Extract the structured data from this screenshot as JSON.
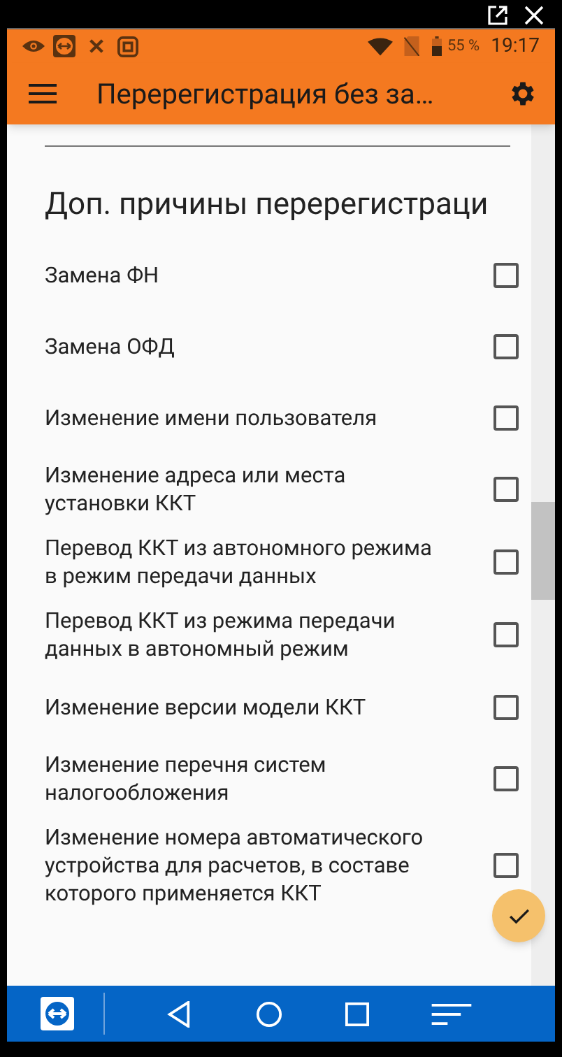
{
  "status_bar": {
    "battery": "55 %",
    "time": "19:17"
  },
  "app_bar": {
    "title": "Перерегистрация без за…"
  },
  "section": {
    "title": "Доп. причины перерегистраци"
  },
  "reasons": [
    {
      "label": "Замена ФН",
      "checked": false
    },
    {
      "label": "Замена ОФД",
      "checked": false
    },
    {
      "label": "Изменение имени пользователя",
      "checked": false
    },
    {
      "label": "Изменение адреса или места установки ККТ",
      "checked": false
    },
    {
      "label": "Перевод ККТ из автономного режима в режим передачи данных",
      "checked": false
    },
    {
      "label": "Перевод ККТ из режима передачи данных в автономный режим",
      "checked": false
    },
    {
      "label": "Изменение версии модели ККТ",
      "checked": false
    },
    {
      "label": "Изменение перечня систем налогообложения",
      "checked": false
    },
    {
      "label": "Изменение номера автоматического устройства для расчетов, в составе которого применяется ККТ",
      "checked": false
    }
  ]
}
